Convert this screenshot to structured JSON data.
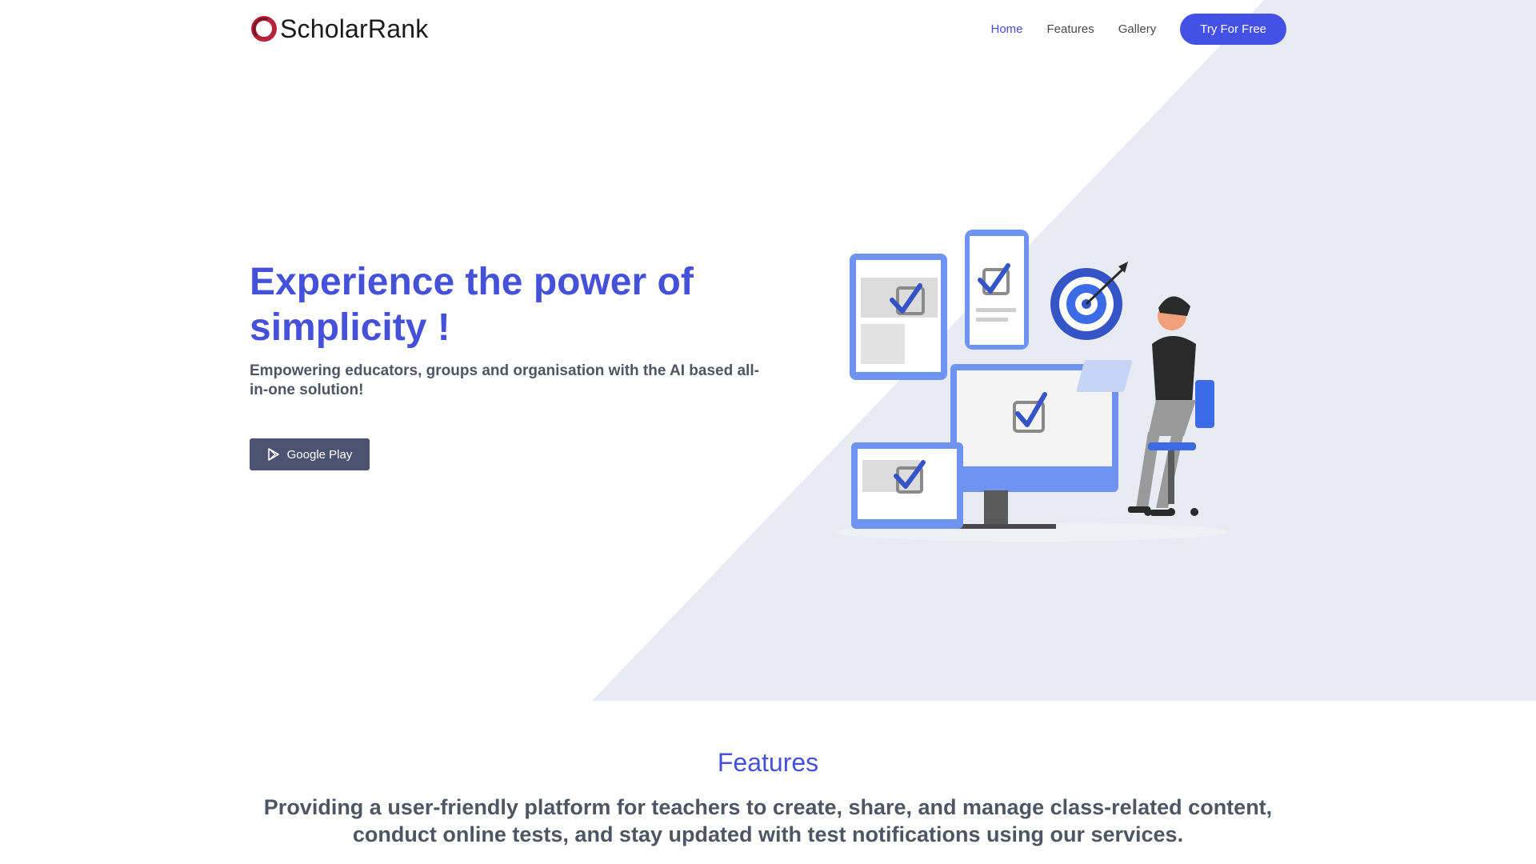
{
  "brand": {
    "name": "ScholarRank",
    "accent": "#4451d8",
    "logo_color": "#b3243a"
  },
  "nav": {
    "items": [
      {
        "label": "Home",
        "active": true
      },
      {
        "label": "Features",
        "active": false
      },
      {
        "label": "Gallery",
        "active": false
      }
    ],
    "cta_label": "Try For Free"
  },
  "hero": {
    "title": "Experience the power of simplicity !",
    "subtitle": "Empowering educators, groups and organisation with the AI based all-in-one solution!",
    "store_button": {
      "label": "Google Play",
      "icon": "play-store-icon"
    },
    "illustration": "person-with-devices-and-target-illustration"
  },
  "features": {
    "title": "Features",
    "description": "Providing a user-friendly platform for teachers to create, share, and manage class-related content, conduct online tests, and stay updated with test notifications using our services."
  }
}
